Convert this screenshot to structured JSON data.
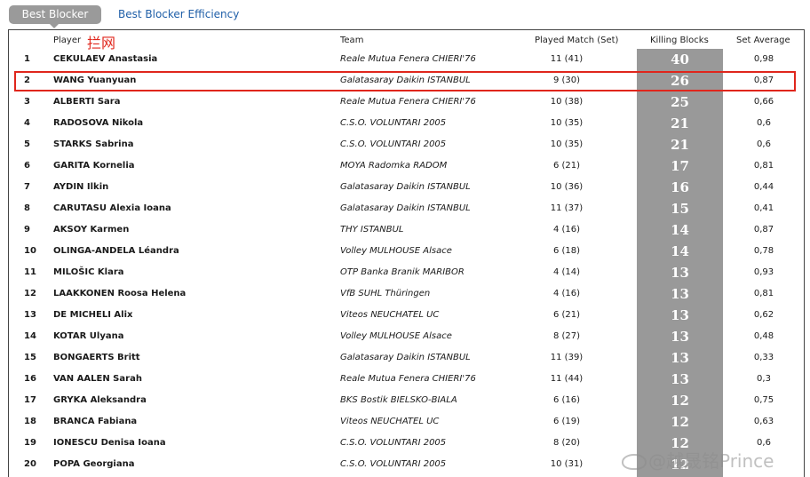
{
  "tabs": [
    {
      "label": "Best Blocker",
      "active": true
    },
    {
      "label": "Best Blocker Efficiency",
      "active": false
    }
  ],
  "columns": {
    "player": "Player",
    "team": "Team",
    "played": "Played Match (Set)",
    "killing": "Killing Blocks",
    "average": "Set Average"
  },
  "annotation": "拦网",
  "highlighted_rank": "2",
  "rows": [
    {
      "rank": "1",
      "player": "CEKULAEV Anastasia",
      "team": "Reale Mutua Fenera CHIERI'76",
      "played": "11 (41)",
      "kills": "40",
      "avg": "0,98"
    },
    {
      "rank": "2",
      "player": "WANG Yuanyuan",
      "team": "Galatasaray Daikin ISTANBUL",
      "played": "9 (30)",
      "kills": "26",
      "avg": "0,87"
    },
    {
      "rank": "3",
      "player": "ALBERTI Sara",
      "team": "Reale Mutua Fenera CHIERI'76",
      "played": "10 (38)",
      "kills": "25",
      "avg": "0,66"
    },
    {
      "rank": "4",
      "player": "RADOSOVA Nikola",
      "team": "C.S.O. VOLUNTARI 2005",
      "played": "10 (35)",
      "kills": "21",
      "avg": "0,6"
    },
    {
      "rank": "5",
      "player": "STARKS Sabrina",
      "team": "C.S.O. VOLUNTARI 2005",
      "played": "10 (35)",
      "kills": "21",
      "avg": "0,6"
    },
    {
      "rank": "6",
      "player": "GARITA Kornelia",
      "team": "MOYA Radomka RADOM",
      "played": "6 (21)",
      "kills": "17",
      "avg": "0,81"
    },
    {
      "rank": "7",
      "player": "AYDIN Ilkin",
      "team": "Galatasaray Daikin ISTANBUL",
      "played": "10 (36)",
      "kills": "16",
      "avg": "0,44"
    },
    {
      "rank": "8",
      "player": "CARUTASU Alexia Ioana",
      "team": "Galatasaray Daikin ISTANBUL",
      "played": "11 (37)",
      "kills": "15",
      "avg": "0,41"
    },
    {
      "rank": "9",
      "player": "AKSOY Karmen",
      "team": "THY ISTANBUL",
      "played": "4 (16)",
      "kills": "14",
      "avg": "0,87"
    },
    {
      "rank": "10",
      "player": "OLINGA-ANDELA Léandra",
      "team": "Volley MULHOUSE Alsace",
      "played": "6 (18)",
      "kills": "14",
      "avg": "0,78"
    },
    {
      "rank": "11",
      "player": "MILOŠIC Klara",
      "team": "OTP Banka Branik MARIBOR",
      "played": "4 (14)",
      "kills": "13",
      "avg": "0,93"
    },
    {
      "rank": "12",
      "player": "LAAKKONEN Roosa Helena",
      "team": "VfB SUHL Thüringen",
      "played": "4 (16)",
      "kills": "13",
      "avg": "0,81"
    },
    {
      "rank": "13",
      "player": "DE MICHELI Alix",
      "team": "Viteos NEUCHATEL UC",
      "played": "6 (21)",
      "kills": "13",
      "avg": "0,62"
    },
    {
      "rank": "14",
      "player": "KOTAR Ulyana",
      "team": "Volley MULHOUSE Alsace",
      "played": "8 (27)",
      "kills": "13",
      "avg": "0,48"
    },
    {
      "rank": "15",
      "player": "BONGAERTS Britt",
      "team": "Galatasaray Daikin ISTANBUL",
      "played": "11 (39)",
      "kills": "13",
      "avg": "0,33"
    },
    {
      "rank": "16",
      "player": "VAN AALEN Sarah",
      "team": "Reale Mutua Fenera CHIERI'76",
      "played": "11 (44)",
      "kills": "13",
      "avg": "0,3"
    },
    {
      "rank": "17",
      "player": "GRYKA Aleksandra",
      "team": "BKS Bostik BIELSKO-BIALA",
      "played": "6 (16)",
      "kills": "12",
      "avg": "0,75"
    },
    {
      "rank": "18",
      "player": "BRANCA Fabiana",
      "team": "Viteos NEUCHATEL UC",
      "played": "6 (19)",
      "kills": "12",
      "avg": "0,63"
    },
    {
      "rank": "19",
      "player": "IONESCU Denisa Ioana",
      "team": "C.S.O. VOLUNTARI 2005",
      "played": "8 (20)",
      "kills": "12",
      "avg": "0,6"
    },
    {
      "rank": "20",
      "player": "POPA Georgiana",
      "team": "C.S.O. VOLUNTARI 2005",
      "played": "10 (31)",
      "kills": "12",
      "avg": ""
    }
  ],
  "watermark": "@越晟铭Prince",
  "colors": {
    "accent_link": "#1f5fa8",
    "tab_bg": "#9a9a9a",
    "kills_column": "#999999",
    "highlight": "#e0261c"
  }
}
